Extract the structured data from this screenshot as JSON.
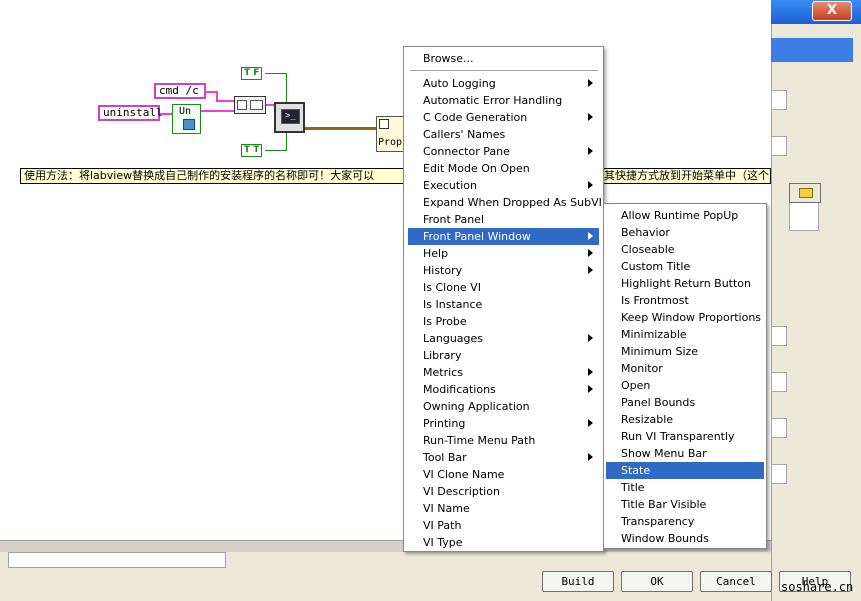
{
  "diagram": {
    "cmd_const": "cmd /c",
    "uninstall_const": "uninstall",
    "bool_true_top": "T F",
    "bool_true_bottom": "T T",
    "sub_vi_label": "Un",
    "property_node_label": "Prop",
    "note_text": "使用方法：将labview替换成自己制作的安装程序的名称即可！大家可以",
    "note_text_tail": "其快捷方式放到开始菜单中（这个"
  },
  "dialog": {
    "close_label": "X",
    "buttons": {
      "build": "Build",
      "ok": "OK",
      "cancel": "Cancel",
      "help": "Help"
    }
  },
  "watermark": "soshare.cn",
  "menu": {
    "items": [
      {
        "label": "Browse...",
        "submenu": false
      },
      {
        "label": "Auto Logging",
        "submenu": true
      },
      {
        "label": "Automatic Error Handling",
        "submenu": false
      },
      {
        "label": "C Code Generation",
        "submenu": true
      },
      {
        "label": "Callers' Names",
        "submenu": false
      },
      {
        "label": "Connector Pane",
        "submenu": true
      },
      {
        "label": "Edit Mode On Open",
        "submenu": false
      },
      {
        "label": "Execution",
        "submenu": true
      },
      {
        "label": "Expand When Dropped As SubVI",
        "submenu": false
      },
      {
        "label": "Front Panel",
        "submenu": false
      },
      {
        "label": "Front Panel Window",
        "submenu": true,
        "highlighted": true
      },
      {
        "label": "Help",
        "submenu": true
      },
      {
        "label": "History",
        "submenu": true
      },
      {
        "label": "Is Clone VI",
        "submenu": false
      },
      {
        "label": "Is Instance",
        "submenu": false
      },
      {
        "label": "Is Probe",
        "submenu": false
      },
      {
        "label": "Languages",
        "submenu": true
      },
      {
        "label": "Library",
        "submenu": false
      },
      {
        "label": "Metrics",
        "submenu": true
      },
      {
        "label": "Modifications",
        "submenu": true
      },
      {
        "label": "Owning Application",
        "submenu": false
      },
      {
        "label": "Printing",
        "submenu": true
      },
      {
        "label": "Run-Time Menu Path",
        "submenu": false
      },
      {
        "label": "Tool Bar",
        "submenu": true
      },
      {
        "label": "VI Clone Name",
        "submenu": false
      },
      {
        "label": "VI Description",
        "submenu": false
      },
      {
        "label": "VI Name",
        "submenu": false
      },
      {
        "label": "VI Path",
        "submenu": false
      },
      {
        "label": "VI Type",
        "submenu": false
      }
    ]
  },
  "submenu": {
    "items": [
      {
        "label": "Allow Runtime PopUp"
      },
      {
        "label": "Behavior"
      },
      {
        "label": "Closeable"
      },
      {
        "label": "Custom Title"
      },
      {
        "label": "Highlight Return Button"
      },
      {
        "label": "Is Frontmost"
      },
      {
        "label": "Keep Window Proportions"
      },
      {
        "label": "Minimizable"
      },
      {
        "label": "Minimum Size"
      },
      {
        "label": "Monitor"
      },
      {
        "label": "Open"
      },
      {
        "label": "Panel Bounds"
      },
      {
        "label": "Resizable"
      },
      {
        "label": "Run VI Transparently"
      },
      {
        "label": "Show Menu Bar"
      },
      {
        "label": "State",
        "highlighted": true
      },
      {
        "label": "Title"
      },
      {
        "label": "Title Bar Visible"
      },
      {
        "label": "Transparency"
      },
      {
        "label": "Window Bounds"
      }
    ]
  },
  "colors": {
    "highlight": "#3169c6",
    "string_wire": "#ef40d0",
    "bool_wire": "#1a8a1a",
    "note_bg": "#ffffd0"
  }
}
